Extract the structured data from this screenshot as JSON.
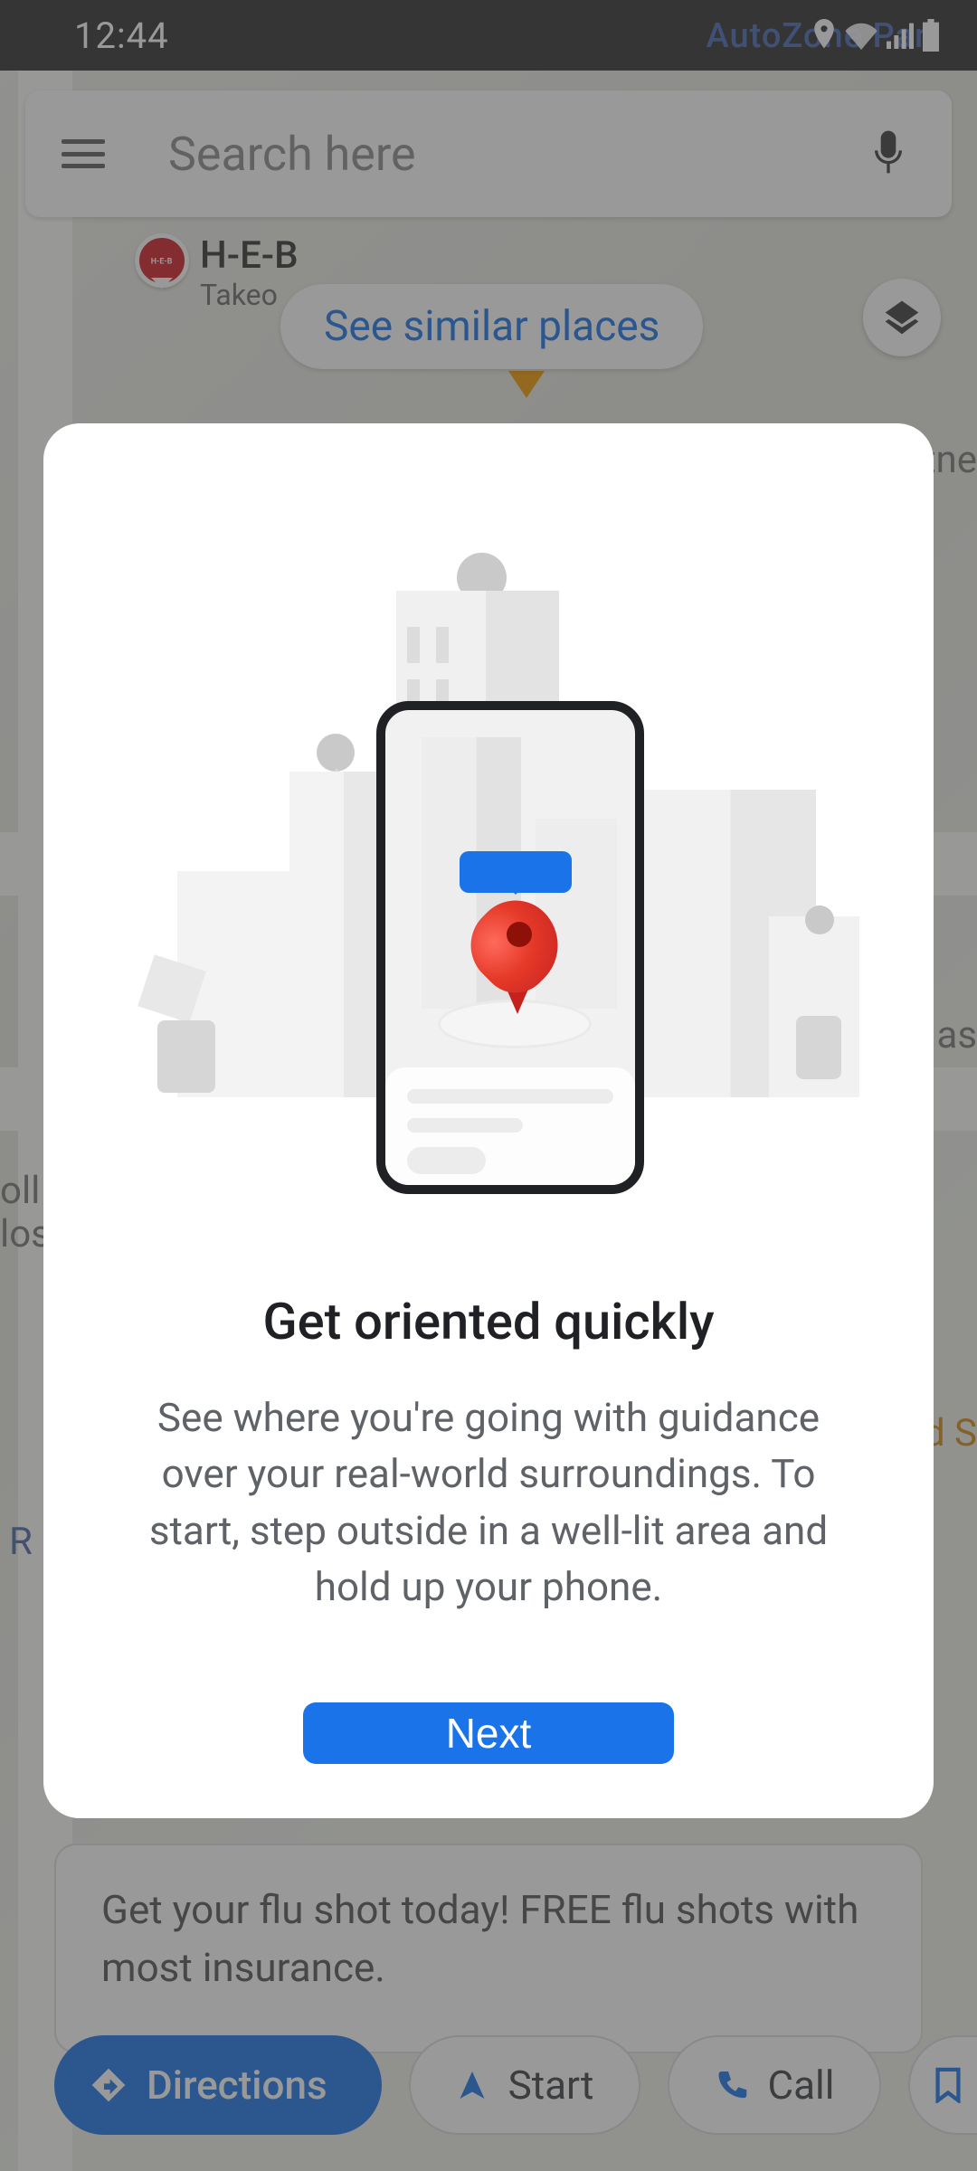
{
  "status": {
    "time": "12:44",
    "autozone_text": "AutoZone        Part"
  },
  "search": {
    "placeholder": "Search here"
  },
  "poi": {
    "name": "H-E-B",
    "subtitle": "Takeo",
    "pin_label": "H-E-B"
  },
  "similar_chip": "See similar places",
  "map_text": {
    "oll": "oll",
    "lose": "lose",
    "itne": "itne",
    "as": "as",
    "ds": "d S",
    "r": "R"
  },
  "bottom_card": {
    "text": "Get your flu shot today! FREE flu shots with most insurance."
  },
  "chips": {
    "directions": "Directions",
    "start": "Start",
    "call": "Call"
  },
  "dialog": {
    "title": "Get oriented quickly",
    "body": "See where you're going with guidance over your real-world surroundings. To start, step outside in a well-lit area and hold up your phone.",
    "next": "Next"
  }
}
